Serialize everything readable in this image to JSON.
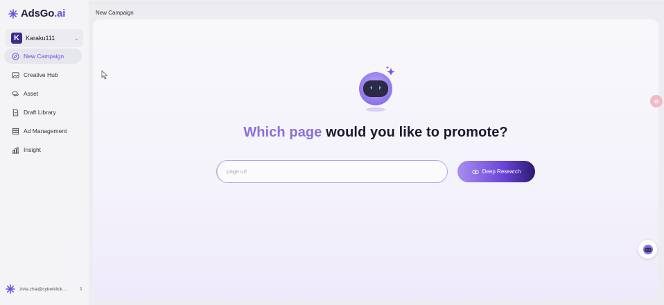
{
  "brand": {
    "name_main": "AdsGo",
    "name_suffix": ".ai",
    "accent": "#6d4ce0"
  },
  "workspace": {
    "initial": "K",
    "name": "Karaku111"
  },
  "nav": [
    {
      "label": "New Campaign",
      "icon": "compass-icon",
      "active": true
    },
    {
      "label": "Creative Hub",
      "icon": "image-icon",
      "active": false
    },
    {
      "label": "Asset",
      "icon": "stack-icon",
      "active": false
    },
    {
      "label": "Draft Library",
      "icon": "file-icon",
      "active": false
    },
    {
      "label": "Ad Management",
      "icon": "list-icon",
      "active": false
    },
    {
      "label": "Insight",
      "icon": "chart-icon",
      "active": false
    }
  ],
  "user": {
    "email": "zivia.zhai@cyberklick...."
  },
  "breadcrumb": "New Campaign",
  "main": {
    "headline_highlight": "Which page",
    "headline_rest": " would you like to promote?",
    "url_placeholder": "page url",
    "research_button": "Deep Research"
  }
}
